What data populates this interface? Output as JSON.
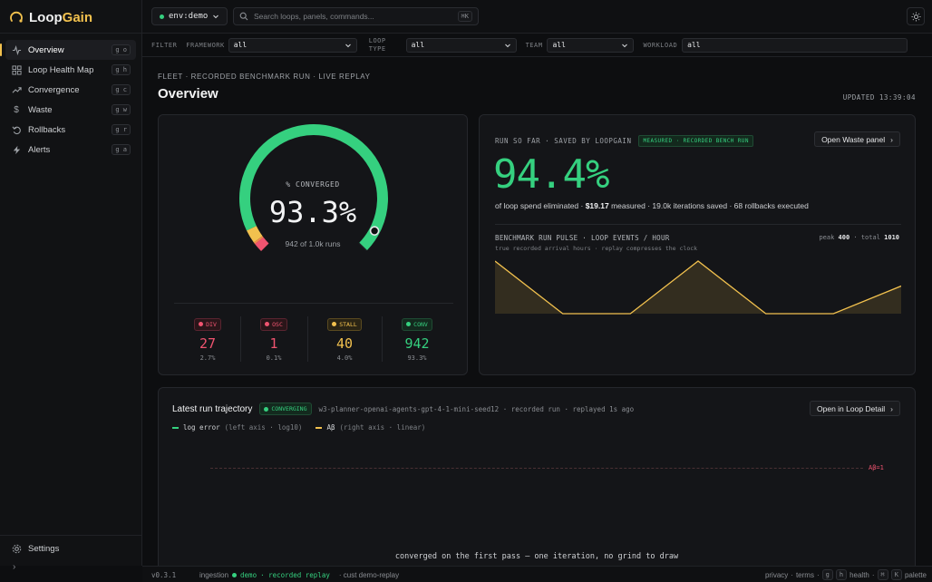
{
  "brand": {
    "name_a": "Loop",
    "name_b": "Gain"
  },
  "sidebar": {
    "items": [
      {
        "label": "Overview",
        "shortcut": "g o",
        "icon": "activity-icon"
      },
      {
        "label": "Loop Health Map",
        "shortcut": "g h",
        "icon": "grid-icon"
      },
      {
        "label": "Convergence",
        "shortcut": "g c",
        "icon": "trend-icon"
      },
      {
        "label": "Waste",
        "shortcut": "g w",
        "icon": "dollar-icon"
      },
      {
        "label": "Rollbacks",
        "shortcut": "g r",
        "icon": "rollback-icon"
      },
      {
        "label": "Alerts",
        "shortcut": "g a",
        "icon": "bolt-icon"
      }
    ],
    "settings_label": "Settings",
    "expand_label": "›"
  },
  "topbar": {
    "env_label": "env:demo",
    "search_placeholder": "Search loops, panels, commands...",
    "search_shortcut": "⌘K"
  },
  "filters": {
    "label": "FILTER",
    "framework": {
      "label": "FRAMEWORK",
      "value": "all"
    },
    "loop_type": {
      "label_1": "LOOP",
      "label_2": "TYPE",
      "value": "all"
    },
    "team": {
      "label": "TEAM",
      "value": "all"
    },
    "workload": {
      "label": "WORKLOAD",
      "value": "all"
    }
  },
  "page": {
    "eyebrow": "FLEET · RECORDED BENCHMARK RUN · LIVE REPLAY",
    "title": "Overview",
    "updated": "UPDATED 13:39:04"
  },
  "gauge": {
    "label": "% CONVERGED",
    "value": "93.3%",
    "sub": "942 of 1.0k runs",
    "fraction": 0.933,
    "stats": [
      {
        "tag": "DIV",
        "value": "27",
        "pct": "2.7%",
        "color": "#f05470"
      },
      {
        "tag": "OSC",
        "value": "1",
        "pct": "0.1%",
        "color": "#f05470"
      },
      {
        "tag": "STALL",
        "value": "40",
        "pct": "4.0%",
        "color": "#f2c14e"
      },
      {
        "tag": "CONV",
        "value": "942",
        "pct": "93.3%",
        "color": "#35d07f"
      }
    ]
  },
  "savings": {
    "eyebrow": "RUN SO FAR · SAVED BY LOOPGAIN",
    "badge": "MEASURED · RECORDED BENCH RUN",
    "button": "Open Waste panel",
    "big_value": "94.4%",
    "desc_a": "of loop spend eliminated · ",
    "desc_amount": "$19.17",
    "desc_b": " measured · 19.0k iterations saved · 68 rollbacks executed"
  },
  "pulse": {
    "title": "BENCHMARK RUN PULSE · LOOP EVENTS / HOUR",
    "sub": "true recorded arrival hours · replay compresses the clock",
    "peak_label": "peak",
    "peak_value": "400",
    "total_label": "total",
    "total_value": "1010"
  },
  "chart_data": {
    "type": "area",
    "title": "BENCHMARK RUN PULSE · LOOP EVENTS / HOUR",
    "x": [
      0,
      1,
      2,
      3,
      4,
      5,
      6
    ],
    "values": [
      400,
      0,
      0,
      400,
      0,
      0,
      210
    ],
    "ylim": [
      0,
      400
    ],
    "color": "#f2c14e"
  },
  "trajectory": {
    "title": "Latest run trajectory",
    "status": "CONVERGING",
    "meta": "w3-planner-openai-agents-gpt-4-1-mini-seed12 · recorded run · replayed 1s ago",
    "button": "Open in Loop Detail",
    "legend_a": "log error",
    "legend_a_sub": "(left axis · log10)",
    "legend_b": "Aβ",
    "legend_b_sub": "(right axis · linear)",
    "ref_label": "Aβ=1",
    "empty_msg": "converged on the first pass — one iteration, no grind to draw"
  },
  "footer": {
    "version": "v0.3.1",
    "ingestion": "ingestion",
    "env": "demo",
    "mode": "· recorded replay",
    "cust": "· cust demo-replay",
    "privacy": "privacy",
    "terms": "terms",
    "k1": "g",
    "k2": "h",
    "health": "health",
    "k3": "⌘",
    "k4": "K",
    "palette": "palette"
  }
}
